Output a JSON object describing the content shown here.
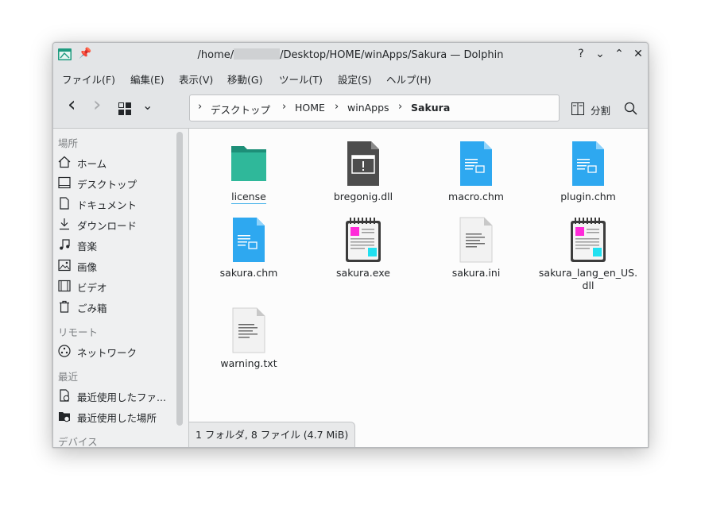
{
  "window": {
    "title_prefix": "/home/",
    "title_suffix": "/Desktop/HOME/winApps/Sakura — Dolphin",
    "help_btn": "?",
    "min_btn": "⌄",
    "max_btn": "⌃",
    "close_btn": "✕"
  },
  "menu": [
    "ファイル(F)",
    "編集(E)",
    "表示(V)",
    "移動(G)",
    "ツール(T)",
    "設定(S)",
    "ヘルプ(H)"
  ],
  "toolbar": {
    "back": "‹",
    "forward": "›",
    "view_dropdown": "⌄",
    "split_label": "分割",
    "search": "⌕"
  },
  "breadcrumb": {
    "items": [
      "デスクトップ",
      "HOME",
      "winApps",
      "Sakura"
    ],
    "sep": "›"
  },
  "sidebar": {
    "places_label": "場所",
    "places": [
      "ホーム",
      "デスクトップ",
      "ドキュメント",
      "ダウンロード",
      "音楽",
      "画像",
      "ビデオ",
      "ごみ箱"
    ],
    "remote_label": "リモート",
    "remote": [
      "ネットワーク"
    ],
    "recent_label": "最近",
    "recent": [
      "最近使用したファ...",
      "最近使用した場所"
    ],
    "devices_label": "デバイス"
  },
  "files": [
    {
      "name": "license",
      "type": "folder"
    },
    {
      "name": "bregonig.dll",
      "type": "dll"
    },
    {
      "name": "macro.chm",
      "type": "chm"
    },
    {
      "name": "plugin.chm",
      "type": "chm"
    },
    {
      "name": "sakura.chm",
      "type": "chm"
    },
    {
      "name": "sakura.exe",
      "type": "exe"
    },
    {
      "name": "sakura.ini",
      "type": "text"
    },
    {
      "name": "sakura_lang_en_US.\ndll",
      "type": "exe"
    },
    {
      "name": "warning.txt",
      "type": "text"
    }
  ],
  "status": "1 フォルダ, 8 ファイル (4.7 MiB)",
  "colors": {
    "folder": "#2fb89a",
    "chm": "#2ea8f0",
    "accent": "#3daee9"
  }
}
